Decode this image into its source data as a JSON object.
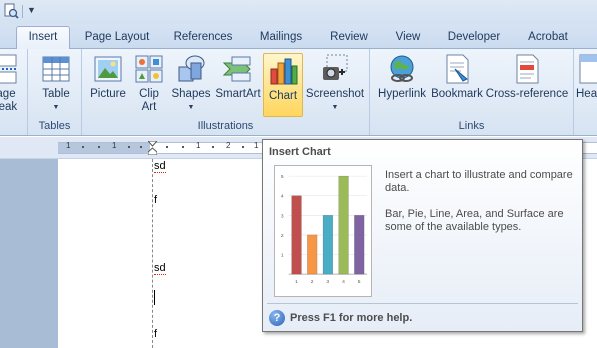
{
  "tabs": [
    {
      "label": "Insert",
      "active": true
    },
    {
      "label": "Page Layout"
    },
    {
      "label": "References"
    },
    {
      "label": "Mailings"
    },
    {
      "label": "Review"
    },
    {
      "label": "View"
    },
    {
      "label": "Developer"
    },
    {
      "label": "Acrobat"
    }
  ],
  "ribbon": {
    "page_break": {
      "line1": "age",
      "line2": "reak"
    },
    "tables_group": {
      "label": "Tables",
      "table_button": "Table"
    },
    "illustrations_group": {
      "label": "Illustrations",
      "picture": "Picture",
      "clipart_line1": "Clip",
      "clipart_line2": "Art",
      "shapes": "Shapes",
      "smartart": "SmartArt",
      "chart": "Chart",
      "screenshot": "Screenshot"
    },
    "links_group": {
      "label": "Links",
      "hyperlink": "Hyperlink",
      "bookmark": "Bookmark",
      "crossref": "Cross-reference"
    },
    "header_partial": "Hea"
  },
  "ruler": {
    "numbers": [
      "1",
      "1",
      "1",
      "2",
      "1"
    ]
  },
  "document": {
    "lines": [
      "sd",
      "f",
      "sd",
      "f"
    ]
  },
  "tooltip": {
    "title": "Insert Chart",
    "description1": "Insert a chart to illustrate and compare data.",
    "description2": "Bar, Pie, Line, Area, and Surface are some of the available types.",
    "help": "Press F1 for more help.",
    "chart_axis_labels": [
      "5",
      "4",
      "3",
      "2",
      "1"
    ],
    "chart_categories": [
      "1",
      "2",
      "3",
      "4",
      "5"
    ],
    "chart_values": [
      4,
      2,
      3,
      5,
      3
    ],
    "chart_colors": [
      "#c0504d",
      "#f79646",
      "#4bacc6",
      "#9bbb59",
      "#8064a2"
    ]
  },
  "colors": {
    "ribbon_bg": "#e0eaf6",
    "hover": "#ffe48c",
    "workspace": "#a9bcd5"
  }
}
